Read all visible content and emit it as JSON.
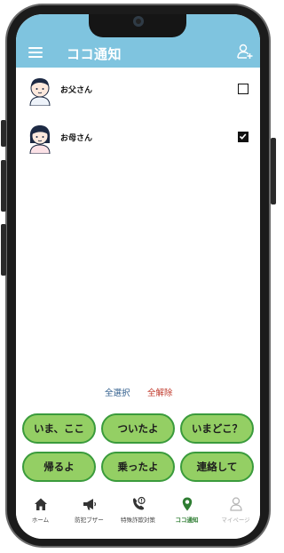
{
  "header": {
    "title": "ココ通知"
  },
  "contacts": [
    {
      "name": "お父さん",
      "checked": false
    },
    {
      "name": "お母さん",
      "checked": true
    }
  ],
  "selection": {
    "select_all": "全選択",
    "clear_all": "全解除"
  },
  "quick_messages": [
    "いま、ここ",
    "ついたよ",
    "いまどこ？",
    "帰るよ",
    "乗ったよ",
    "連絡して"
  ],
  "nav": [
    {
      "label": "ホーム",
      "icon": "home-icon"
    },
    {
      "label": "防犯ブザー",
      "icon": "megaphone-icon"
    },
    {
      "label": "特殊詐欺対策",
      "icon": "phone-shield-icon"
    },
    {
      "label": "ココ通知",
      "icon": "location-pin-icon",
      "active": true
    },
    {
      "label": "マイページ",
      "icon": "user-icon",
      "disabled": true
    }
  ],
  "colors": {
    "header": "#7fc4df",
    "button_fill": "#94cf64",
    "button_border": "#3a9b3c",
    "active_nav": "#2e7d32"
  }
}
